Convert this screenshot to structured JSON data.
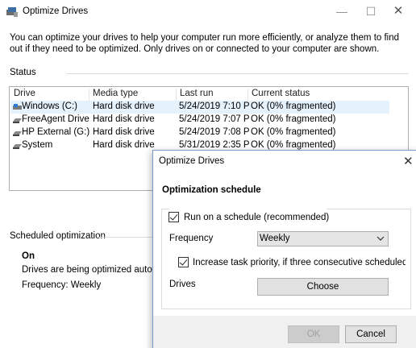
{
  "window": {
    "title": "Optimize Drives",
    "minimize_glyph": "—",
    "maximize_glyph": "☐",
    "close_glyph": "✕"
  },
  "intro_text": "You can optimize your drives to help your computer run more efficiently, or analyze them to find out if they need to be optimized. Only drives on or connected to your computer are shown.",
  "status": {
    "heading": "Status",
    "columns": [
      "Drive",
      "Media type",
      "Last run",
      "Current status"
    ],
    "rows": [
      {
        "drive": "Windows (C:)",
        "media": "Hard disk drive",
        "last_run": "5/24/2019 7:10 PM",
        "status": "OK (0% fragmented)",
        "icon": "windows-drive-icon"
      },
      {
        "drive": "FreeAgent Drive (...",
        "media": "Hard disk drive",
        "last_run": "5/24/2019 7:07 PM",
        "status": "OK (0% fragmented)",
        "icon": "drive-icon"
      },
      {
        "drive": "HP External (G:)",
        "media": "Hard disk drive",
        "last_run": "5/24/2019 7:08 PM",
        "status": "OK (0% fragmented)",
        "icon": "drive-icon"
      },
      {
        "drive": "System",
        "media": "Hard disk drive",
        "last_run": "5/31/2019 2:35 PM",
        "status": "OK (0% fragmented)",
        "icon": "drive-icon"
      }
    ]
  },
  "scheduled": {
    "heading": "Scheduled optimization",
    "state": "On",
    "description": "Drives are being optimized automatica",
    "frequency": "Frequency: Weekly"
  },
  "dialog": {
    "title": "Optimize Drives",
    "close_glyph": "✕",
    "heading": "Optimization schedule",
    "run_on_schedule_label": "Run on a schedule (recommended)",
    "frequency_label": "Frequency",
    "frequency_value": "Weekly",
    "increase_priority_label": "Increase task priority, if three consecutive scheduled runs are m",
    "drives_label": "Drives",
    "choose_label": "Choose",
    "ok_label": "OK",
    "cancel_label": "Cancel"
  },
  "colors": {
    "selected_row": "#e5f1fb",
    "dialog_border": "#7a9ccc",
    "button_face": "#e1e1e1"
  }
}
